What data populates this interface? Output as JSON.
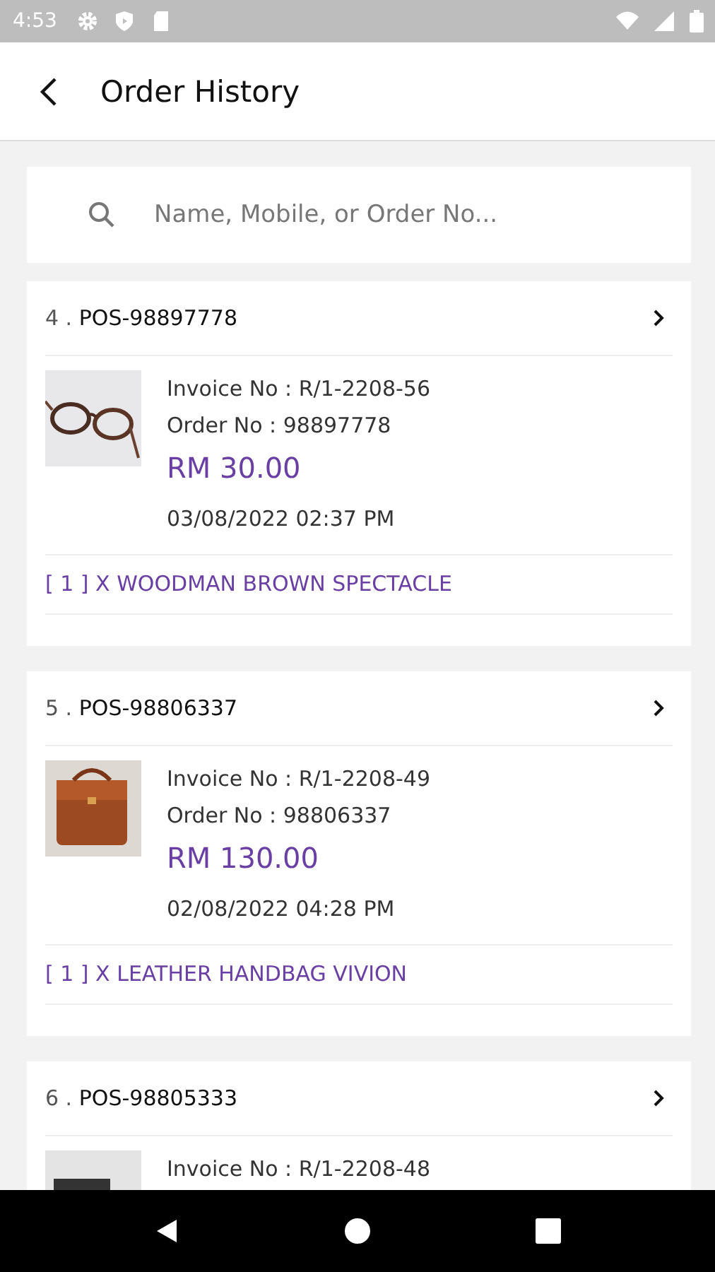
{
  "status_bar": {
    "time": "4:53"
  },
  "header": {
    "title": "Order History"
  },
  "search": {
    "placeholder": "Name, Mobile, or Order No..."
  },
  "orders": [
    {
      "index": "4 .",
      "code": "POS-98897778",
      "invoice": "Invoice No : R/1-2208-56",
      "order_no": "Order No : 98897778",
      "amount": "RM 30.00",
      "date": "03/08/2022 02:37 PM",
      "items": [
        "[ 1 ] X WOODMAN BROWN SPECTACLE"
      ]
    },
    {
      "index": "5 .",
      "code": "POS-98806337",
      "invoice": "Invoice No : R/1-2208-49",
      "order_no": "Order No : 98806337",
      "amount": "RM 130.00",
      "date": "02/08/2022 04:28 PM",
      "items": [
        "[ 1 ] X LEATHER HANDBAG VIVION"
      ]
    },
    {
      "index": "6 .",
      "code": "POS-98805333",
      "invoice": "Invoice No : R/1-2208-48"
    }
  ]
}
